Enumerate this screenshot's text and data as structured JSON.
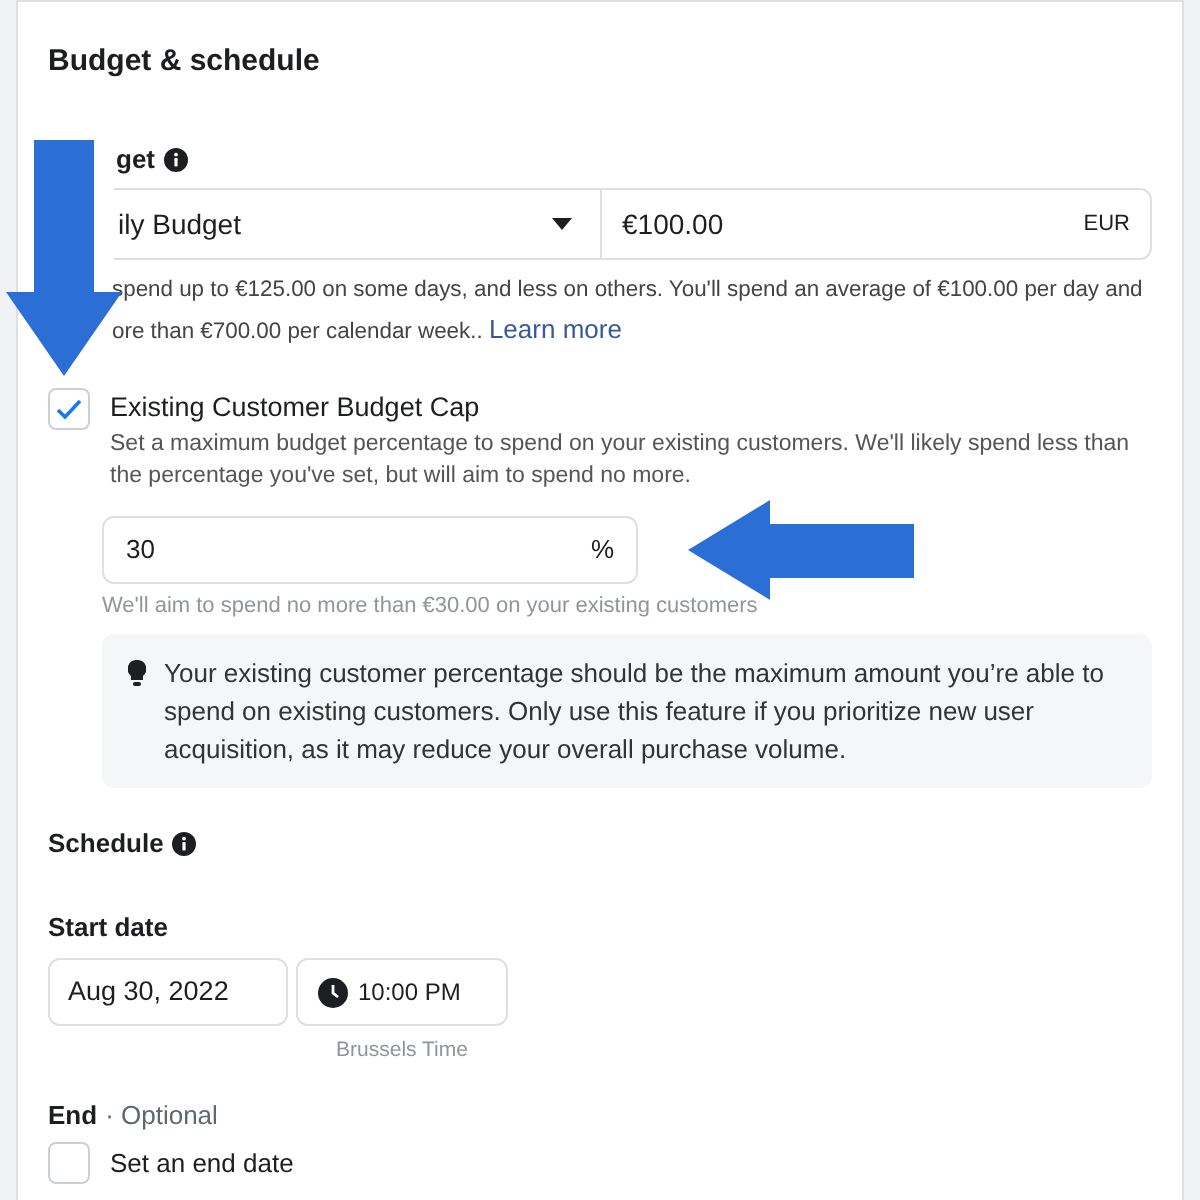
{
  "card": {
    "title": "Budget & schedule"
  },
  "budget": {
    "label": "get",
    "budget_type": {
      "value": "ily Budget"
    },
    "amount": {
      "value": "€100.00",
      "currency": "EUR"
    },
    "help_lines": [
      "spend up to €125.00 on some days, and less on others. You'll spend an average of €100.00 per day and",
      "ore than €700.00 per calendar week.."
    ],
    "learn_more": "Learn more"
  },
  "customer_cap": {
    "label": "Existing Customer Budget Cap",
    "checked": true,
    "description": "Set a maximum budget percentage to spend on your existing customers. We'll likely spend less than the percentage you've set, but will aim to spend no more.",
    "percent": {
      "value": "30",
      "unit": "%"
    },
    "note": "We'll aim to spend no more than €30.00 on your existing customers",
    "tip": "Your existing customer percentage should be the maximum amount you’re able to spend on existing customers. Only use this feature if you prioritize new user acquisition, as it may reduce your overall purchase volume."
  },
  "schedule": {
    "label": "Schedule",
    "start_label": "Start date",
    "date": "Aug 30, 2022",
    "time": "10:00 PM",
    "timezone": "Brussels Time",
    "end_label": "End",
    "end_optional": "· Optional",
    "end_date": {
      "label": "Set an end date",
      "checked": false
    }
  }
}
